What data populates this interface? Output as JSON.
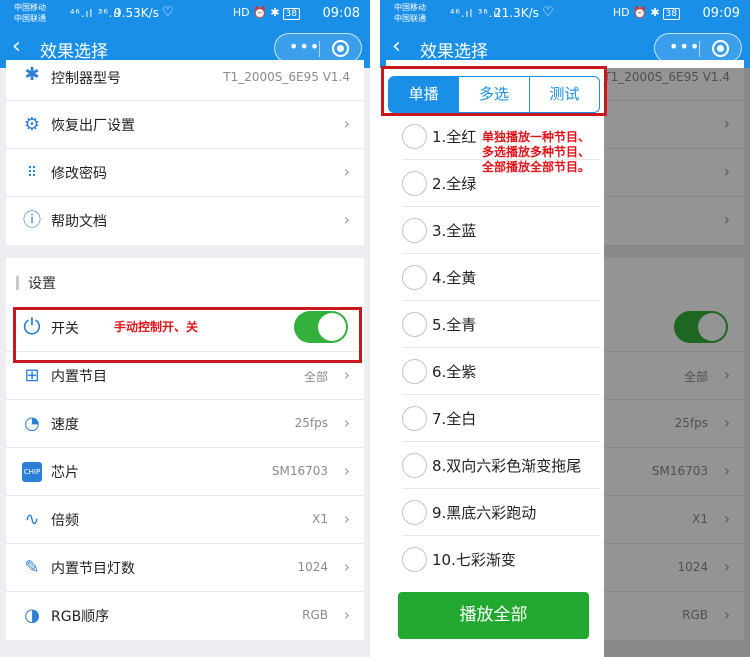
{
  "colors": {
    "primary": "#1a8fe8",
    "toggle_on": "#34b13d",
    "annotation": "#e0151c",
    "play_button": "#22a830"
  },
  "left": {
    "status": {
      "carrier1": "中国移动",
      "carrier2": "中国联通",
      "signal": "⁴⁶.ıl ³⁶.ıl",
      "speed": "9.53K/s",
      "time": "09:08",
      "battery": "38"
    },
    "nav": {
      "title": "效果选择",
      "back_icon": "back-arrow-icon",
      "more_icon": "more-dots-icon",
      "close_icon": "capsule-close-icon"
    },
    "top_items": [
      {
        "icon": "bluetooth-icon",
        "label": "控制器型号",
        "value": "T1_2000S_6E95 V1.4"
      },
      {
        "icon": "gear-icon",
        "label": "恢复出厂设置"
      },
      {
        "icon": "keypad-icon",
        "label": "修改密码"
      },
      {
        "icon": "help-icon",
        "label": "帮助文档"
      }
    ],
    "section_title": "设置",
    "switch": {
      "label": "开关",
      "on": true,
      "icon": "power-icon"
    },
    "annotation_switch": "手动控制开、关",
    "settings": [
      {
        "icon": "grid-icon",
        "label": "内置节目",
        "value": "全部"
      },
      {
        "icon": "speedometer-icon",
        "label": "速度",
        "value": "25fps"
      },
      {
        "icon": "chip-icon",
        "label": "芯片",
        "value": "SM16703"
      },
      {
        "icon": "waveform-icon",
        "label": "倍频",
        "value": "X1"
      },
      {
        "icon": "edit-icon",
        "label": "内置节目灯数",
        "value": "1024"
      },
      {
        "icon": "palette-icon",
        "label": "RGB顺序",
        "value": "RGB"
      }
    ]
  },
  "right": {
    "status": {
      "carrier1": "中国移动",
      "carrier2": "中国联通",
      "signal": "⁴⁶.ıl ³⁶.ıl",
      "speed": "21.3K/s",
      "time": "09:09",
      "battery": "38"
    },
    "nav": {
      "title": "效果选择"
    },
    "bg": {
      "model_value": "T1_2000S_6E95 V1.4",
      "values": [
        "全部",
        "25fps",
        "SM16703",
        "X1",
        "1024",
        "RGB"
      ]
    },
    "tabs": [
      "单播",
      "多选",
      "测试"
    ],
    "active_tab": 0,
    "options": [
      "1.全红",
      "2.全绿",
      "3.全蓝",
      "4.全黄",
      "5.全青",
      "6.全紫",
      "7.全白",
      "8.双向六彩色渐变拖尾",
      "9.黑底六彩跑动",
      "10.七彩渐变"
    ],
    "annotation": [
      "单独播放一种节目、",
      "多选播放多种节目、",
      "全部播放全部节目。"
    ],
    "play_all": "播放全部"
  }
}
